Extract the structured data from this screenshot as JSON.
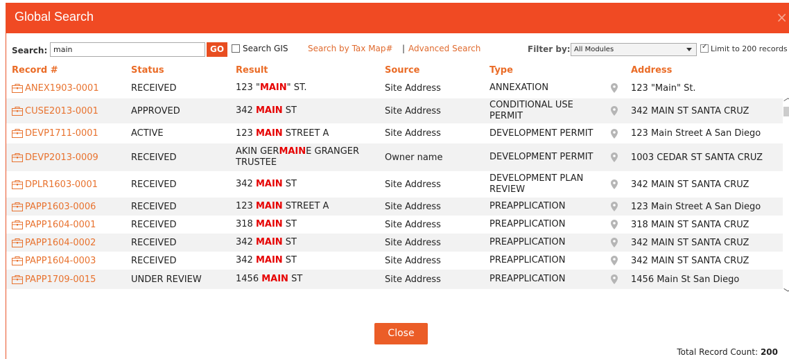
{
  "dialog": {
    "title": "Global Search",
    "close_icon": "×"
  },
  "search": {
    "label": "Search:",
    "value": "main",
    "go_label": "GO",
    "gis_label": "Search GIS",
    "tax_map_link": "Search by Tax Map#",
    "separator": "|",
    "advanced_link": "Advanced Search",
    "filter_label": "Filter by:",
    "filter_value": "All Modules",
    "limit_label": "Limit to 200 records"
  },
  "columns": {
    "record": "Record #",
    "status": "Status",
    "result": "Result",
    "source": "Source",
    "type": "Type",
    "address": "Address"
  },
  "rows": [
    {
      "record": "ANEX1903-0001",
      "status": "RECEIVED",
      "result_pre": "123 \"",
      "result_hl": "MAIN",
      "result_post": "\" ST.",
      "source": "Site Address",
      "type": "ANNEXATION",
      "address": "123 \"Main\" St."
    },
    {
      "record": "CUSE2013-0001",
      "status": "APPROVED",
      "result_pre": "342 ",
      "result_hl": "MAIN",
      "result_post": " ST",
      "source": "Site Address",
      "type": "CONDITIONAL USE PERMIT",
      "address": "342 MAIN ST SANTA CRUZ"
    },
    {
      "record": "DEVP1711-0001",
      "status": "ACTIVE",
      "result_pre": "123 ",
      "result_hl": "MAIN",
      "result_post": " STREET A",
      "source": "Site Address",
      "type": "DEVELOPMENT PERMIT",
      "address": "123 Main Street A San Diego"
    },
    {
      "record": "DEVP2013-0009",
      "status": "RECEIVED",
      "result_pre": "AKIN GER",
      "result_hl": "MAIN",
      "result_post": "E GRANGER TRUSTEE",
      "source": "Owner name",
      "type": "DEVELOPMENT PERMIT",
      "address": "1003 CEDAR ST SANTA CRUZ"
    },
    {
      "record": "DPLR1603-0001",
      "status": "RECEIVED",
      "result_pre": "342 ",
      "result_hl": "MAIN",
      "result_post": " ST",
      "source": "Site Address",
      "type": "DEVELOPMENT PLAN REVIEW",
      "address": "342 MAIN ST SANTA CRUZ"
    },
    {
      "record": "PAPP1603-0006",
      "status": "RECEIVED",
      "result_pre": "123 ",
      "result_hl": "MAIN",
      "result_post": " STREET A",
      "source": "Site Address",
      "type": "PREAPPLICATION",
      "address": "123 Main Street A San Diego"
    },
    {
      "record": "PAPP1604-0001",
      "status": "RECEIVED",
      "result_pre": "318 ",
      "result_hl": "MAIN",
      "result_post": " ST",
      "source": "Site Address",
      "type": "PREAPPLICATION",
      "address": "318 MAIN ST SANTA CRUZ"
    },
    {
      "record": "PAPP1604-0002",
      "status": "RECEIVED",
      "result_pre": "342 ",
      "result_hl": "MAIN",
      "result_post": " ST",
      "source": "Site Address",
      "type": "PREAPPLICATION",
      "address": "342 MAIN ST SANTA CRUZ"
    },
    {
      "record": "PAPP1604-0003",
      "status": "RECEIVED",
      "result_pre": "342 ",
      "result_hl": "MAIN",
      "result_post": " ST",
      "source": "Site Address",
      "type": "PREAPPLICATION",
      "address": "342 MAIN ST SANTA CRUZ"
    },
    {
      "record": "PAPP1709-0015",
      "status": "UNDER REVIEW",
      "result_pre": "1456 ",
      "result_hl": "MAIN",
      "result_post": " ST",
      "source": "Site Address",
      "type": "PREAPPLICATION",
      "address": "1456 Main St San Diego"
    }
  ],
  "footer": {
    "close_label": "Close",
    "total_label": "Total Record Count:",
    "total_value": "200"
  },
  "icons": {
    "record": "folder-icon",
    "address": "map-pin-icon"
  },
  "colors": {
    "accent": "#f04a23",
    "link": "#e8722e",
    "highlight": "#e60000"
  }
}
